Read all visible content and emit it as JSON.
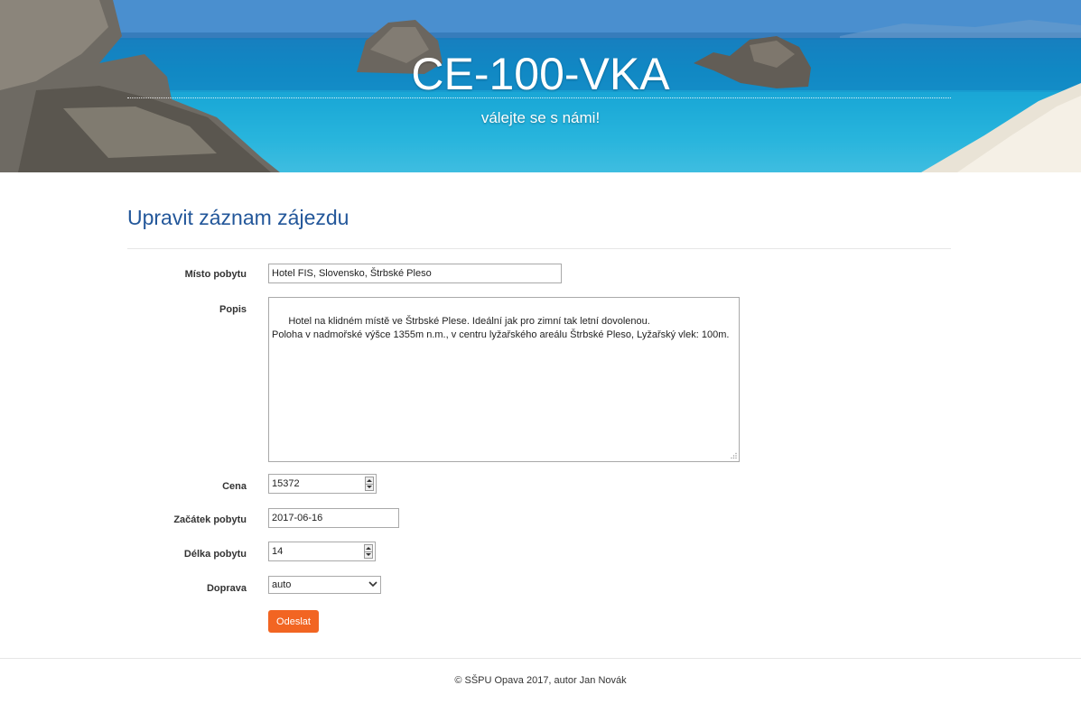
{
  "header": {
    "site_title": "CE-100-VKA",
    "tagline": "válejte se s námi!"
  },
  "page": {
    "heading": "Upravit záznam zájezdu"
  },
  "form": {
    "misto": {
      "label": "Místo pobytu",
      "value": "Hotel FIS, Slovensko, Štrbské Pleso"
    },
    "popis": {
      "label": "Popis",
      "value": "Hotel na klidném místě ve Štrbské Plese. Ideální jak pro zimní tak letní dovolenou.\nPoloha v nadmořské výšce 1355m n.m., v centru lyžařského areálu Štrbské Pleso, Lyžařský vlek: 100m."
    },
    "cena": {
      "label": "Cena",
      "value": "15372"
    },
    "zacatek": {
      "label": "Začátek pobytu",
      "value": "2017-06-16"
    },
    "delka": {
      "label": "Délka pobytu",
      "value": "14"
    },
    "doprava": {
      "label": "Doprava",
      "value": "auto"
    },
    "submit_label": "Odeslat"
  },
  "footer": {
    "text": "© SŠPU Opava 2017, autor Jan Novák"
  },
  "colors": {
    "heading": "#23579a",
    "button": "#f26522"
  }
}
